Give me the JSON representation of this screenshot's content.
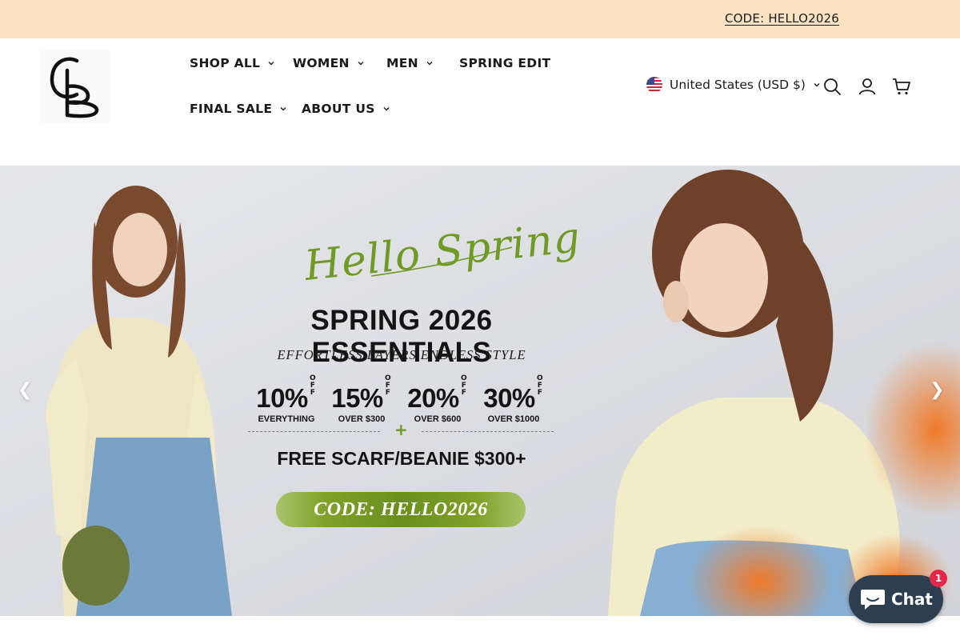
{
  "announcement": {
    "code_link": "CODE: HELLO2026"
  },
  "header": {
    "logo_text": "CB",
    "nav": [
      {
        "label": "SHOP ALL",
        "has_dropdown": true
      },
      {
        "label": "WOMEN",
        "has_dropdown": true
      },
      {
        "label": "MEN",
        "has_dropdown": true
      },
      {
        "label": "SPRING EDIT",
        "has_dropdown": false
      },
      {
        "label": "FINAL SALE",
        "has_dropdown": true
      },
      {
        "label": "ABOUT US",
        "has_dropdown": true
      }
    ],
    "locale": "United States (USD $)",
    "icons": [
      "search-icon",
      "account-icon",
      "cart-icon"
    ]
  },
  "hero": {
    "script_title": "Hello Spring",
    "headline": "SPRING 2026 ESSENTIALS",
    "tagline": "EFFORTLESS LAYERS  ENDLESS STYLE",
    "offers": [
      {
        "percent": "10%",
        "off": "OFF",
        "condition": "EVERYTHING"
      },
      {
        "percent": "15%",
        "off": "OFF",
        "condition": "OVER $300"
      },
      {
        "percent": "20%",
        "off": "OFF",
        "condition": "OVER $600"
      },
      {
        "percent": "30%",
        "off": "OFF",
        "condition": "OVER $1000"
      }
    ],
    "plus": "+",
    "gift": "FREE SCARF/BEANIE $300+",
    "code": "CODE: HELLO2026",
    "prev_arrow": "❮",
    "next_arrow": "❯"
  },
  "chat": {
    "label": "Chat",
    "badge_count": "1"
  },
  "colors": {
    "announcement_bg": "#fde3c2",
    "accent_green": "#6f9a25",
    "chat_bg": "#2c3e50",
    "badge_red": "#e3274a"
  }
}
